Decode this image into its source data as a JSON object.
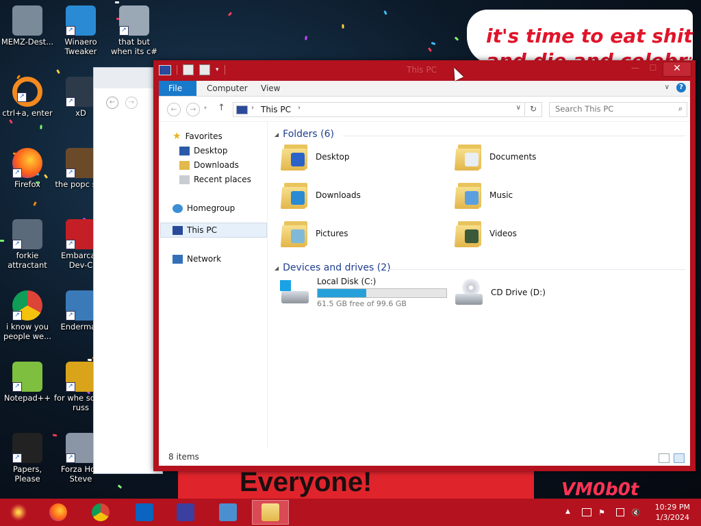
{
  "desktop": {
    "icons": [
      {
        "label": "MEMZ-Dest...",
        "icon": "recycle-bin-icon"
      },
      {
        "label": "Winaero Tweaker",
        "icon": "winaero-icon"
      },
      {
        "label": "that but when its c#",
        "icon": "stacked-windows-icon"
      },
      {
        "label": "ctrl+a, enter",
        "icon": "ring-icon"
      },
      {
        "label": "xD",
        "icon": "hxd-icon"
      },
      {
        "label": "Firefox",
        "icon": "firefox-icon"
      },
      {
        "label": "the popc shit",
        "icon": "book-icon"
      },
      {
        "label": "forkie attractant",
        "icon": "monitor-gear-icon"
      },
      {
        "label": "Embarcad Dev-C",
        "icon": "devcpp-icon"
      },
      {
        "label": "i know you people we...",
        "icon": "chrome-icon"
      },
      {
        "label": "Enderman",
        "icon": "window-icon"
      },
      {
        "label": "Notepad++",
        "icon": "notepadpp-icon"
      },
      {
        "label": "for whe some russ",
        "icon": "di-icon"
      },
      {
        "label": "Papers, Please",
        "icon": "papers-please-icon"
      },
      {
        "label": "Forza Hori Steve",
        "icon": "flash-icon"
      }
    ],
    "meme_top_line1": "it's time to eat shit",
    "meme_top_line2": "and die and celebrate",
    "meme_bottom": "Everyone!",
    "watermark": "VM0b0t"
  },
  "explorer": {
    "title": "This PC",
    "ribbon_tabs": [
      "File",
      "Computer",
      "View"
    ],
    "address_path": "This PC",
    "search_placeholder": "Search This PC",
    "nav": {
      "favorites": "Favorites",
      "desktop": "Desktop",
      "downloads": "Downloads",
      "recent": "Recent places",
      "homegroup": "Homegroup",
      "thispc": "This PC",
      "network": "Network"
    },
    "folders_header": "Folders (6)",
    "folders": [
      "Desktop",
      "Documents",
      "Downloads",
      "Music",
      "Pictures",
      "Videos"
    ],
    "devices_header": "Devices and drives (2)",
    "drives": [
      {
        "name": "Local Disk (C:)",
        "free_text": "61.5 GB free of 99.6 GB",
        "used_fraction": 0.38
      },
      {
        "name": "CD Drive (D:)"
      }
    ],
    "status": "8 items",
    "accent": "#1979ca",
    "frame_color": "#b3121e"
  },
  "taskbar": {
    "time": "10:29 PM",
    "date": "1/3/2024",
    "pinned": [
      "start-icon",
      "firefox-icon",
      "chrome-icon",
      "outlook-icon",
      "settings-icon",
      "control-panel-icon",
      "file-explorer-icon"
    ]
  }
}
